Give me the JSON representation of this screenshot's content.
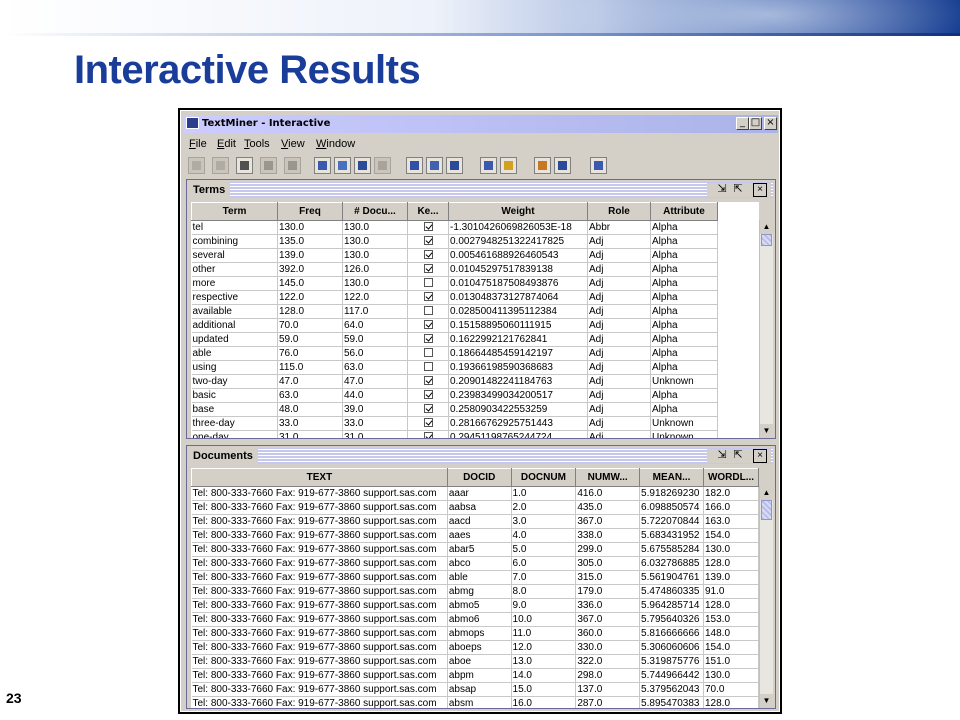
{
  "slide": {
    "title": "Interactive Results",
    "page_number": "23"
  },
  "window": {
    "title": "TextMiner - Interactive",
    "controls": {
      "minimize": "_",
      "maximize": "□",
      "close": "×"
    }
  },
  "menu": [
    "File",
    "Edit",
    "Tools",
    "View",
    "Window"
  ],
  "frame_controls": {
    "restore": "⇲",
    "maximize": "⇱",
    "close": "×"
  },
  "terms": {
    "title": "Terms",
    "columns": [
      "Term",
      "Freq",
      "# Docu...",
      "Ke...",
      "Weight",
      "Role",
      "Attribute"
    ],
    "rows": [
      {
        "term": "tel",
        "freq": "130.0",
        "docs": "130.0",
        "keep": true,
        "weight": "-1.3010426069826053E-18",
        "role": "Abbr",
        "attr": "Alpha"
      },
      {
        "term": "combining",
        "freq": "135.0",
        "docs": "130.0",
        "keep": true,
        "weight": "0.0027948251322417825",
        "role": "Adj",
        "attr": "Alpha"
      },
      {
        "term": "several",
        "freq": "139.0",
        "docs": "130.0",
        "keep": true,
        "weight": "0.005461688926460543",
        "role": "Adj",
        "attr": "Alpha"
      },
      {
        "term": "other",
        "freq": "392.0",
        "docs": "126.0",
        "keep": true,
        "weight": "0.01045297517839138",
        "role": "Adj",
        "attr": "Alpha"
      },
      {
        "term": "more",
        "freq": "145.0",
        "docs": "130.0",
        "keep": false,
        "weight": "0.010475187508493876",
        "role": "Adj",
        "attr": "Alpha"
      },
      {
        "term": "respective",
        "freq": "122.0",
        "docs": "122.0",
        "keep": true,
        "weight": "0.013048373127874064",
        "role": "Adj",
        "attr": "Alpha"
      },
      {
        "term": "available",
        "freq": "128.0",
        "docs": "117.0",
        "keep": false,
        "weight": "0.028500411395112384",
        "role": "Adj",
        "attr": "Alpha"
      },
      {
        "term": "additional",
        "freq": "70.0",
        "docs": "64.0",
        "keep": true,
        "weight": "0.15158895060111915",
        "role": "Adj",
        "attr": "Alpha"
      },
      {
        "term": "updated",
        "freq": "59.0",
        "docs": "59.0",
        "keep": true,
        "weight": "0.1622992121762841",
        "role": "Adj",
        "attr": "Alpha"
      },
      {
        "term": "able",
        "freq": "76.0",
        "docs": "56.0",
        "keep": false,
        "weight": "0.18664485459142197",
        "role": "Adj",
        "attr": "Alpha"
      },
      {
        "term": "using",
        "freq": "115.0",
        "docs": "63.0",
        "keep": false,
        "weight": "0.19366198590368683",
        "role": "Adj",
        "attr": "Alpha"
      },
      {
        "term": "two-day",
        "freq": "47.0",
        "docs": "47.0",
        "keep": true,
        "weight": "0.20901482241184763",
        "role": "Adj",
        "attr": "Unknown"
      },
      {
        "term": "basic",
        "freq": "63.0",
        "docs": "44.0",
        "keep": true,
        "weight": "0.23983499034200517",
        "role": "Adj",
        "attr": "Alpha"
      },
      {
        "term": "base",
        "freq": "48.0",
        "docs": "39.0",
        "keep": true,
        "weight": "0.2580903422553259",
        "role": "Adj",
        "attr": "Alpha"
      },
      {
        "term": "three-day",
        "freq": "33.0",
        "docs": "33.0",
        "keep": true,
        "weight": "0.28166762925751443",
        "role": "Adj",
        "attr": "Unknown"
      },
      {
        "term": "one-day",
        "freq": "31.0",
        "docs": "31.0",
        "keep": true,
        "weight": "0.29451198765244724",
        "role": "Adj",
        "attr": "Unknown"
      }
    ]
  },
  "documents": {
    "title": "Documents",
    "columns": [
      "TEXT",
      "DOCID",
      "DOCNUM",
      "NUMW...",
      "MEAN...",
      "WORDL..."
    ],
    "rows": [
      {
        "text": "Tel: 800-333-7660 Fax: 919-677-3860 support.sas.com",
        "docid": "aaar",
        "docnum": "1.0",
        "numw": "416.0",
        "mean": "5.918269230",
        "wordl": "182.0"
      },
      {
        "text": "Tel: 800-333-7660 Fax: 919-677-3860 support.sas.com",
        "docid": "aabsa",
        "docnum": "2.0",
        "numw": "435.0",
        "mean": "6.098850574",
        "wordl": "166.0"
      },
      {
        "text": "Tel: 800-333-7660 Fax: 919-677-3860 support.sas.com",
        "docid": "aacd",
        "docnum": "3.0",
        "numw": "367.0",
        "mean": "5.722070844",
        "wordl": "163.0"
      },
      {
        "text": "Tel: 800-333-7660 Fax: 919-677-3860 support.sas.com",
        "docid": "aaes",
        "docnum": "4.0",
        "numw": "338.0",
        "mean": "5.683431952",
        "wordl": "154.0"
      },
      {
        "text": "Tel: 800-333-7660 Fax: 919-677-3860 support.sas.com",
        "docid": "abar5",
        "docnum": "5.0",
        "numw": "299.0",
        "mean": "5.675585284",
        "wordl": "130.0"
      },
      {
        "text": "Tel: 800-333-7660 Fax: 919-677-3860 support.sas.com",
        "docid": "abco",
        "docnum": "6.0",
        "numw": "305.0",
        "mean": "6.032786885",
        "wordl": "128.0"
      },
      {
        "text": "Tel: 800-333-7660 Fax: 919-677-3860 support.sas.com",
        "docid": "able",
        "docnum": "7.0",
        "numw": "315.0",
        "mean": "5.561904761",
        "wordl": "139.0"
      },
      {
        "text": "Tel: 800-333-7660 Fax: 919-677-3860 support.sas.com",
        "docid": "abmg",
        "docnum": "8.0",
        "numw": "179.0",
        "mean": "5.474860335",
        "wordl": "91.0"
      },
      {
        "text": "Tel: 800-333-7660 Fax: 919-677-3860 support.sas.com",
        "docid": "abmo5",
        "docnum": "9.0",
        "numw": "336.0",
        "mean": "5.964285714",
        "wordl": "128.0"
      },
      {
        "text": "Tel: 800-333-7660 Fax: 919-677-3860 support.sas.com",
        "docid": "abmo6",
        "docnum": "10.0",
        "numw": "367.0",
        "mean": "5.795640326",
        "wordl": "153.0"
      },
      {
        "text": "Tel: 800-333-7660 Fax: 919-677-3860 support.sas.com",
        "docid": "abmops",
        "docnum": "11.0",
        "numw": "360.0",
        "mean": "5.816666666",
        "wordl": "148.0"
      },
      {
        "text": "Tel: 800-333-7660 Fax: 919-677-3860 support.sas.com",
        "docid": "aboeps",
        "docnum": "12.0",
        "numw": "330.0",
        "mean": "5.306060606",
        "wordl": "154.0"
      },
      {
        "text": "Tel: 800-333-7660 Fax: 919-677-3860 support.sas.com",
        "docid": "aboe",
        "docnum": "13.0",
        "numw": "322.0",
        "mean": "5.319875776",
        "wordl": "151.0"
      },
      {
        "text": "Tel: 800-333-7660 Fax: 919-677-3860 support.sas.com",
        "docid": "abpm",
        "docnum": "14.0",
        "numw": "298.0",
        "mean": "5.744966442",
        "wordl": "130.0"
      },
      {
        "text": "Tel: 800-333-7660 Fax: 919-677-3860 support.sas.com",
        "docid": "absap",
        "docnum": "15.0",
        "numw": "137.0",
        "mean": "5.379562043",
        "wordl": "70.0"
      },
      {
        "text": "Tel: 800-333-7660 Fax: 919-677-3860 support.sas.com",
        "docid": "absm",
        "docnum": "16.0",
        "numw": "287.0",
        "mean": "5.895470383",
        "wordl": "128.0"
      }
    ]
  },
  "toolbar_icons": [
    "new-icon",
    "open-icon",
    "print-icon",
    "save-icon",
    "edit-icon",
    "filter-icon",
    "find-icon",
    "select-icon",
    "undo-icon",
    "chart-icon",
    "grid-icon",
    "table-icon",
    "cluster-icon",
    "tree-icon",
    "bar-chart-icon",
    "book-icon",
    "export-icon"
  ],
  "colors": {
    "accent": "#1a3d99",
    "titlebar": "#ccccff",
    "frame_border": "#6a6a98"
  }
}
